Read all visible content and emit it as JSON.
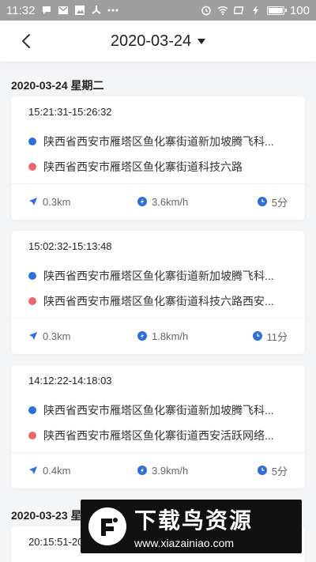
{
  "status_bar": {
    "time": "11:32",
    "battery": "100",
    "battery_level": 1.0,
    "left_icons": [
      "message-icon",
      "gmail-icon",
      "image-icon",
      "fan-icon",
      "more-icon"
    ],
    "right_icons": [
      "alarm-icon",
      "wifi-icon",
      "screen-icon",
      "bolt-icon",
      "battery-icon"
    ]
  },
  "header": {
    "date": "2020-03-24"
  },
  "sections": [
    {
      "title": "2020-03-24 星期二",
      "trips": [
        {
          "time_range": "15:21:31-15:26:32",
          "start": "陕西省西安市雁塔区鱼化寨街道新加坡腾飞科...",
          "end": "陕西省西安市雁塔区鱼化寨街道科技六路",
          "distance": "0.3km",
          "speed": "3.6km/h",
          "duration": "5分"
        },
        {
          "time_range": "15:02:32-15:13:48",
          "start": "陕西省西安市雁塔区鱼化寨街道新加坡腾飞科...",
          "end": "陕西省西安市雁塔区鱼化寨街道科技六路西安...",
          "distance": "0.3km",
          "speed": "1.8km/h",
          "duration": "11分"
        },
        {
          "time_range": "14:12:22-14:18:03",
          "start": "陕西省西安市雁塔区鱼化寨街道新加坡腾飞科...",
          "end": "陕西省西安市雁塔区鱼化寨街道西安活跃网络...",
          "distance": "0.4km",
          "speed": "3.9km/h",
          "duration": "5分"
        }
      ]
    },
    {
      "title": "2020-03-23 星",
      "trips": [
        {
          "time_range": "20:15:51-20"
        }
      ]
    }
  ],
  "watermark": {
    "title": "下载鸟资源",
    "url": "www.xiazainiao.com"
  },
  "colors": {
    "start_dot": "#2f6fdb",
    "end_dot": "#e8696b",
    "icon_blue": "#2f6fdb",
    "status_bar": "#9e9e9e"
  }
}
